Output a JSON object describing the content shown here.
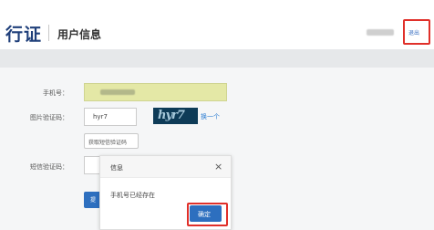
{
  "header": {
    "app_title": "行证",
    "page_title": "用户信息",
    "logout_label": "退出"
  },
  "form": {
    "phone_label": "手机号：",
    "captcha_label": "图片验证码：",
    "captcha_value": "hyr7",
    "captcha_image_text": "hyr7",
    "refresh_link": "换一个",
    "sms_button": "获取短信验证码",
    "sms_label": "短信验证码：",
    "submit_label": "提"
  },
  "modal": {
    "title": "信息",
    "close": "×",
    "message": "手机号已经存在",
    "ok_label": "确定"
  },
  "colors": {
    "accent": "#2d6fbf",
    "highlight": "#e0302a"
  }
}
